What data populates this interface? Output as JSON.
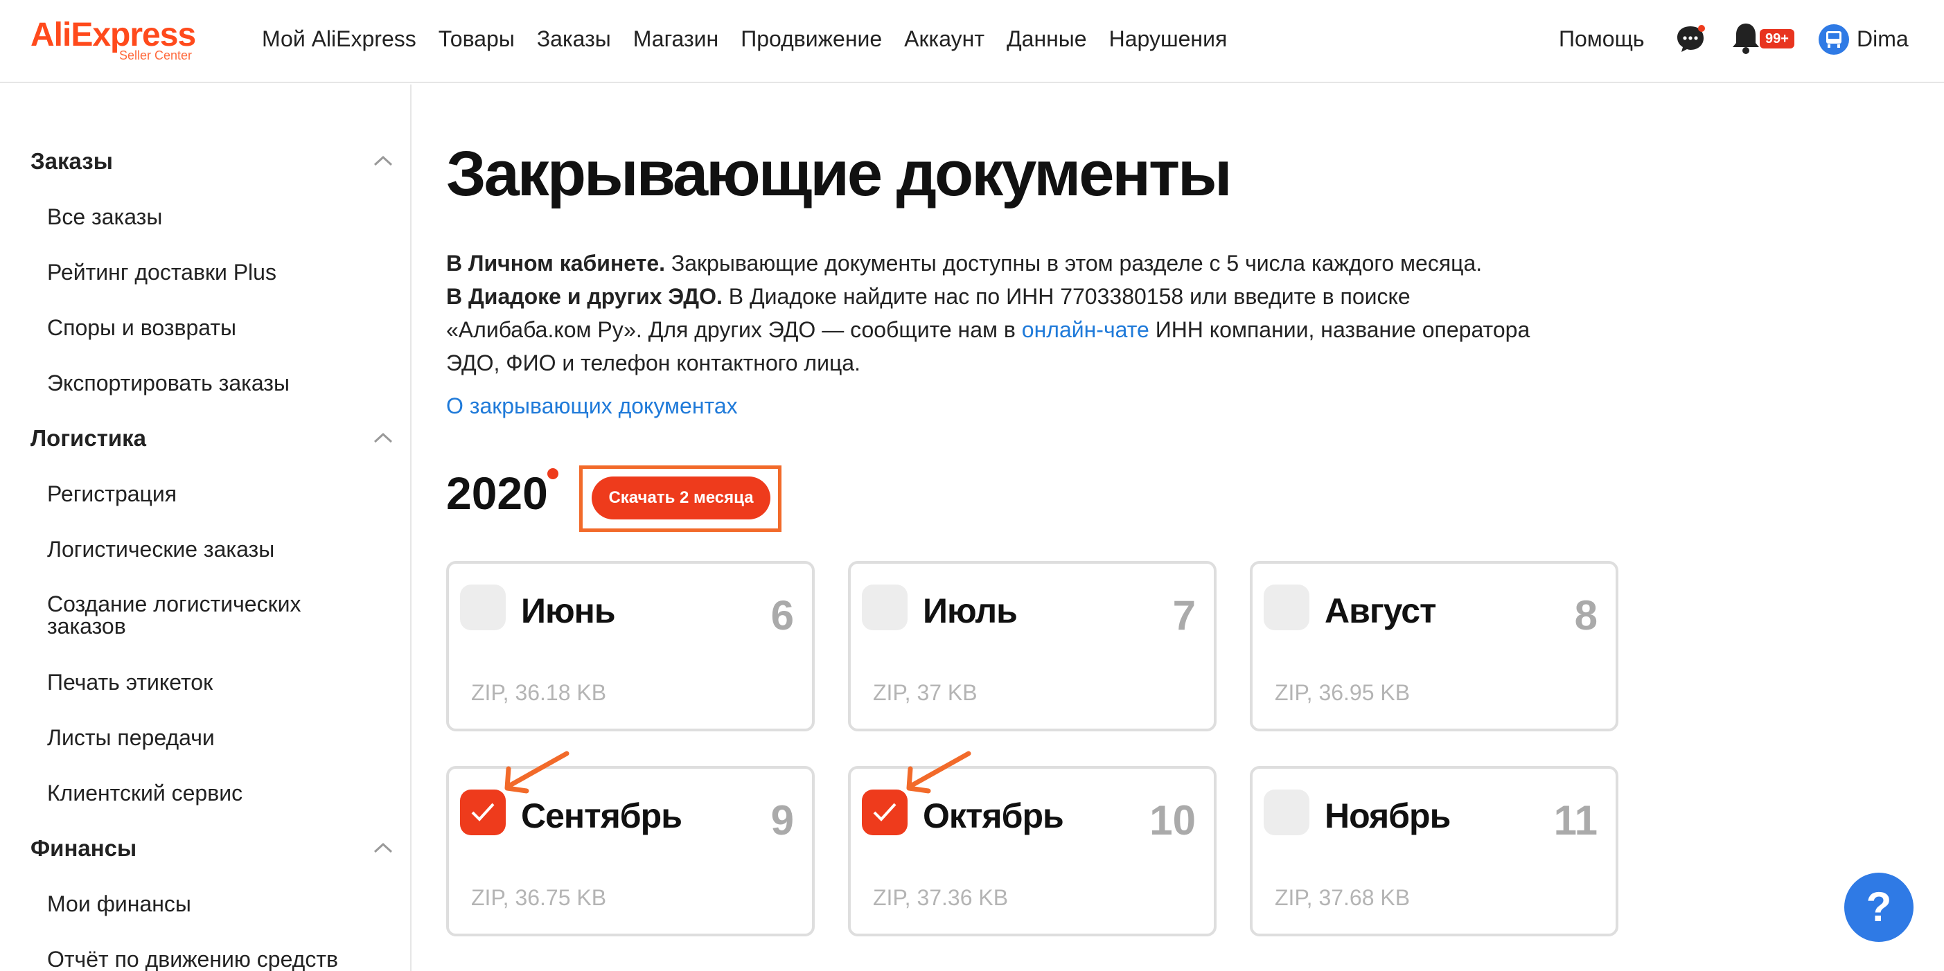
{
  "header": {
    "logo_brand": "AliExpress",
    "logo_sub": "Seller Center",
    "nav": [
      "Мой AliExpress",
      "Товары",
      "Заказы",
      "Магазин",
      "Продвижение",
      "Аккаунт",
      "Данные",
      "Нарушения"
    ],
    "help": "Помощь",
    "badge": "99+",
    "user": "Dima"
  },
  "sidebar": {
    "groups": [
      {
        "title": "Заказы",
        "items": [
          "Все заказы",
          "Рейтинг доставки Plus",
          "Споры и возвраты",
          "Экспортировать заказы"
        ]
      },
      {
        "title": "Логистика",
        "items": [
          "Регистрация",
          "Логистические заказы",
          "Создание логистических заказов",
          "Печать этикеток",
          "Листы передачи",
          "Клиентский сервис"
        ]
      },
      {
        "title": "Финансы",
        "items": [
          "Мои финансы",
          "Отчёт по движению средств"
        ]
      }
    ]
  },
  "main": {
    "title": "Закрывающие документы",
    "desc": {
      "p1_bold": "В Личном кабинете.",
      "p1_text": " Закрывающие документы доступны в этом разделе с 5 числа каждого месяца.",
      "p2_bold": "В Диадоке и других ЭДО.",
      "p2_text": " В Диадоке найдите нас по ИНН 7703380158 или введите в поиске «Алибаба.ком Ру». Для других ЭДО — сообщите нам в ",
      "p2_link": "онлайн-чате",
      "p2_tail": " ИНН компании, название оператора ЭДО, ФИО и телефон контактного лица."
    },
    "about_link": "О закрывающих документах",
    "year": "2020",
    "download_button": "Скачать 2 месяца",
    "months": [
      {
        "name": "Июнь",
        "num": "6",
        "info": "ZIP, 36.18 KB",
        "checked": false
      },
      {
        "name": "Июль",
        "num": "7",
        "info": "ZIP, 37 KB",
        "checked": false
      },
      {
        "name": "Август",
        "num": "8",
        "info": "ZIP, 36.95 KB",
        "checked": false
      },
      {
        "name": "Сентябрь",
        "num": "9",
        "info": "ZIP, 36.75 KB",
        "checked": true
      },
      {
        "name": "Октябрь",
        "num": "10",
        "info": "ZIP, 37.36 KB",
        "checked": true
      },
      {
        "name": "Ноябрь",
        "num": "11",
        "info": "ZIP, 37.68 KB",
        "checked": false
      }
    ],
    "help_fab": "?"
  },
  "colors": {
    "accent": "#ee3b1c",
    "annotation": "#f26a2a",
    "link": "#1f7ad9",
    "fab": "#2f7ae5"
  },
  "icons": [
    "chat-icon",
    "bell-icon",
    "user-icon",
    "chevron-up-icon",
    "checkmark-icon",
    "arrow-annotation-icon"
  ]
}
